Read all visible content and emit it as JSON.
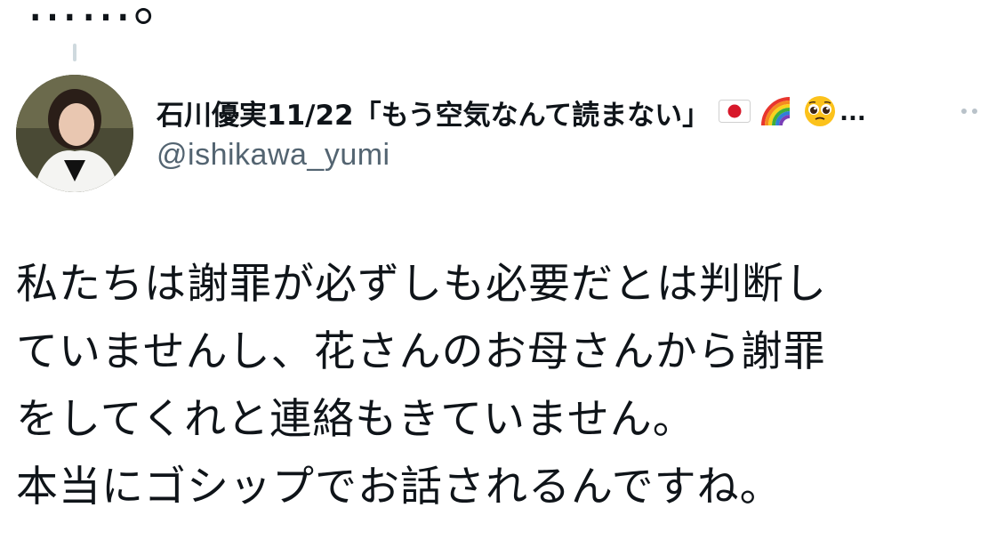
{
  "previous_tweet_fragment": "……。",
  "author": {
    "display_name": "石川優実11/22「もう空気なんて読まない」",
    "name_emojis": [
      "flag-japan-icon",
      "rainbow-icon",
      "pleading-face-icon"
    ],
    "name_truncation": "...",
    "handle": "@ishikawa_yumi"
  },
  "tweet": {
    "lines": [
      "私たちは謝罪が必ずしも必要だとは判断し",
      "ていませんし、花さんのお母さんから謝罪",
      "をしてくれと連絡もきていません。",
      "本当にゴシップでお話されるんですね。"
    ]
  },
  "colors": {
    "text_primary": "#0f1419",
    "text_secondary": "#536471",
    "thread_line": "#cfd9de",
    "background": "#ffffff"
  }
}
